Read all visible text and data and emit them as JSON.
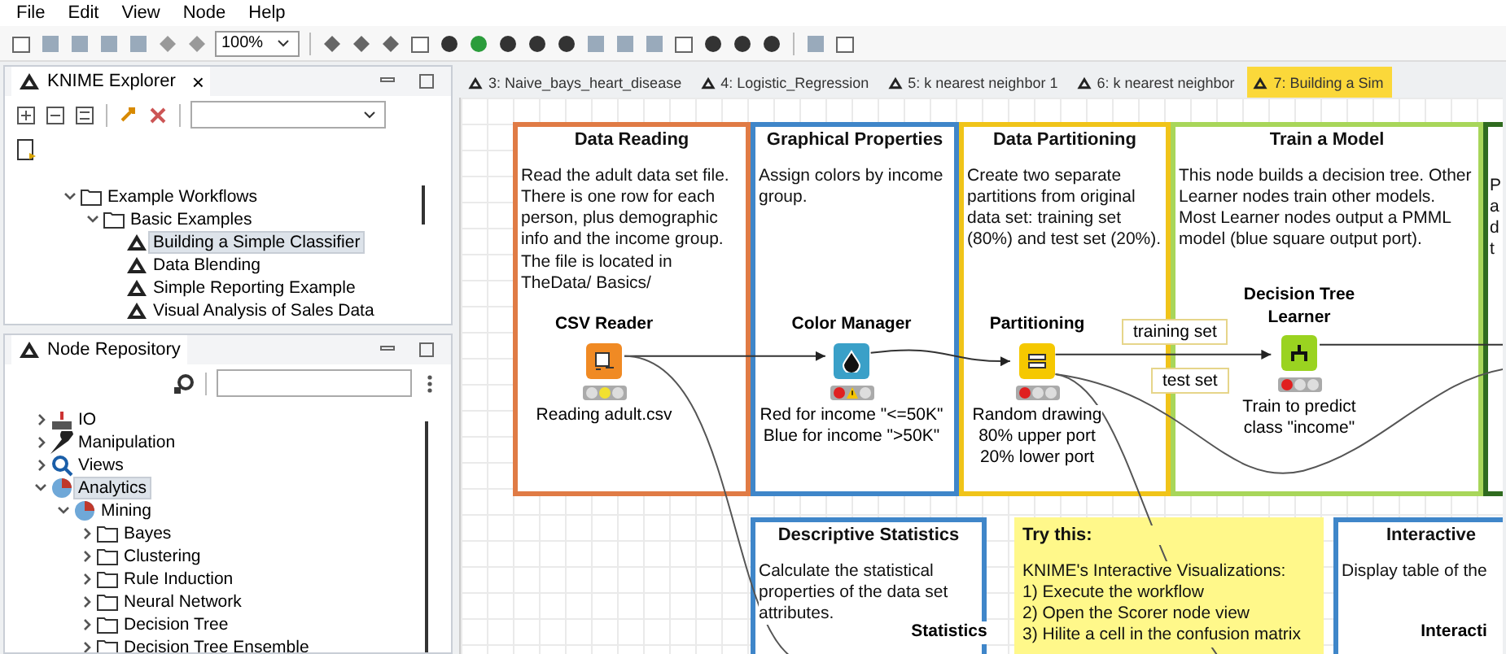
{
  "menu": [
    "File",
    "Edit",
    "View",
    "Node",
    "Help"
  ],
  "toolbar": {
    "zoom": "100%"
  },
  "explorer": {
    "title": "KNIME Explorer",
    "close": "×",
    "tree": [
      {
        "label": "Example Workflows",
        "kind": "folder",
        "expanded": true,
        "selected": false,
        "children": [
          {
            "label": "Basic Examples",
            "kind": "folder",
            "expanded": true,
            "selected": false,
            "children": [
              {
                "label": "Building a Simple Classifier",
                "kind": "workflow",
                "selected": true
              },
              {
                "label": "Data Blending",
                "kind": "workflow",
                "selected": false
              },
              {
                "label": "Simple Reporting Example",
                "kind": "workflow",
                "selected": false
              },
              {
                "label": "Visual Analysis of Sales Data",
                "kind": "workflow",
                "selected": false
              }
            ]
          }
        ]
      }
    ]
  },
  "repository": {
    "title": "Node Repository",
    "tree": [
      {
        "label": "IO",
        "kind": "io",
        "expanded": false,
        "selected": false
      },
      {
        "label": "Manipulation",
        "kind": "manipulation",
        "expanded": false,
        "selected": false
      },
      {
        "label": "Views",
        "kind": "views",
        "expanded": false,
        "selected": false
      },
      {
        "label": "Analytics",
        "kind": "analytics",
        "expanded": true,
        "selected": true,
        "children": [
          {
            "label": "Mining",
            "kind": "analytics",
            "expanded": true,
            "selected": false,
            "children": [
              {
                "label": "Bayes",
                "kind": "folder",
                "expanded": false,
                "selected": false
              },
              {
                "label": "Clustering",
                "kind": "folder",
                "expanded": false,
                "selected": false
              },
              {
                "label": "Rule Induction",
                "kind": "folder",
                "expanded": false,
                "selected": false
              },
              {
                "label": "Neural Network",
                "kind": "folder",
                "expanded": false,
                "selected": false
              },
              {
                "label": "Decision Tree",
                "kind": "folder",
                "expanded": false,
                "selected": false
              },
              {
                "label": "Decision Tree Ensemble",
                "kind": "folder",
                "expanded": false,
                "selected": false
              }
            ]
          }
        ]
      }
    ]
  },
  "tabs": [
    {
      "label": "3: Naive_bays_heart_disease",
      "selected": false
    },
    {
      "label": "4: Logistic_Regression",
      "selected": false
    },
    {
      "label": "5: k nearest neighbor 1",
      "selected": false
    },
    {
      "label": "6: k nearest neighbor",
      "selected": false
    },
    {
      "label": "7: Building a Sim",
      "selected": true
    }
  ],
  "annotations": [
    {
      "kind": "group",
      "title": "Data Reading",
      "text": "Read the adult data set file. There is one row for each person, plus demographic info and the income group. The file is located in TheData/ Basics/",
      "color": "#e07b45"
    },
    {
      "kind": "group",
      "title": "Graphical Properties",
      "text": "Assign colors by income group.",
      "color": "#3f86c9"
    },
    {
      "kind": "group",
      "title": "Data Partitioning",
      "text": "Create two separate partitions from original data set: training set (80%) and test set (20%).",
      "color": "#f0c419"
    },
    {
      "kind": "group",
      "title": "Train a Model",
      "text": "This node builds a decision tree. Other Learner nodes train other models. Most Learner nodes output a PMML model (blue square output port).",
      "color": "#a8d65a"
    },
    {
      "kind": "edge",
      "lines": [
        "P",
        "a",
        "d",
        "t"
      ],
      "color": "#2f6b1f"
    },
    {
      "kind": "group",
      "title": "Descriptive Statistics",
      "text": "Calculate the statistical properties of the data set attributes.",
      "color": "#3f86c9"
    },
    {
      "kind": "note",
      "title": "Try this:",
      "lines": [
        "KNIME's Interactive Visualizations:",
        "1) Execute the workflow",
        "2) Open the Scorer node view",
        "3) Hilite a cell in the confusion matrix"
      ],
      "color": "#fff88a"
    },
    {
      "kind": "group",
      "title": "Interactive",
      "text": "Display table of the",
      "color": "#3f86c9"
    }
  ],
  "nodes": [
    {
      "name": "CSV Reader",
      "kind": "reader",
      "color": "#f1e031",
      "warning": false,
      "description": [
        "Reading adult.csv"
      ]
    },
    {
      "name": "Color Manager",
      "kind": "color",
      "color": "#e02020",
      "warning": true,
      "description": [
        "Red for income \"<=50K\"",
        "Blue for income \">50K\""
      ]
    },
    {
      "name": "Partitioning",
      "kind": "partition",
      "color": "#e02020",
      "warning": false,
      "description": [
        "Random drawing",
        "80% upper port",
        "20% lower port"
      ]
    },
    {
      "name": "Decision Tree Learner",
      "kind": "learner",
      "color": "#e02020",
      "warning": false,
      "description": [
        "Train to predict",
        "class \"income\""
      ]
    },
    {
      "name": "Statistics",
      "kind": "stats"
    },
    {
      "name": "Interacti",
      "kind": "table"
    }
  ],
  "port_labels": [
    "training set",
    "test set"
  ]
}
